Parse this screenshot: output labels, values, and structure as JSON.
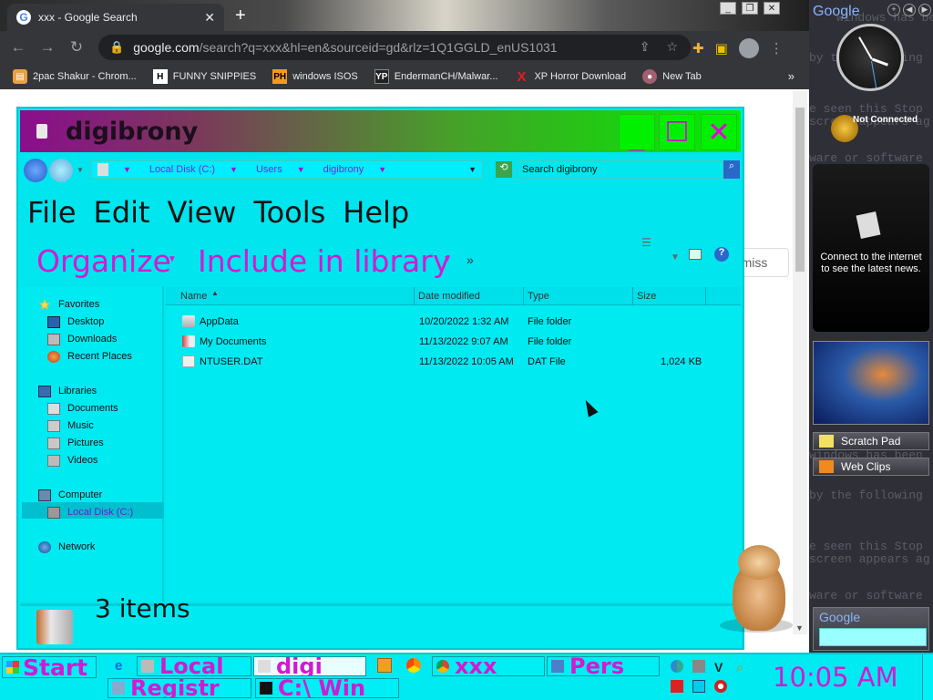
{
  "chrome": {
    "tab_title": "xxx - Google Search",
    "tab_close": "✕",
    "new_tab": "+",
    "url_host": "google.com",
    "url_path": "/search?q=xxx&hl=en&sourceid=gd&rlz=1Q1GGLD_enUS1031",
    "bookmarks": [
      {
        "label": "2pac Shakur - Chrom...",
        "icon": "chrome-store-icon"
      },
      {
        "label": "FUNNY SNIPPIES",
        "icon": "h-logo-icon"
      },
      {
        "label": "windows ISOS",
        "icon": "ph-logo-icon"
      },
      {
        "label": "EndermanCH/Malwar...",
        "icon": "yp-logo-icon"
      },
      {
        "label": "XP Horror Download",
        "icon": "x-logo-icon"
      },
      {
        "label": "New Tab",
        "icon": "globe-icon"
      }
    ],
    "bookmarks_more": "»",
    "dismiss_label": "miss"
  },
  "explorer": {
    "title": "digibrony",
    "breadcrumbs": [
      "Local Disk (C:)",
      "Users",
      "digibrony"
    ],
    "search_placeholder": "Search digibrony",
    "menu": [
      "File",
      "Edit",
      "View",
      "Tools",
      "Help"
    ],
    "commands": {
      "organize": "Organize",
      "include": "Include in library",
      "more": "»"
    },
    "nav": {
      "favorites": "Favorites",
      "favorites_items": [
        "Desktop",
        "Downloads",
        "Recent Places"
      ],
      "libraries": "Libraries",
      "libraries_items": [
        "Documents",
        "Music",
        "Pictures",
        "Videos"
      ],
      "computer": "Computer",
      "computer_items": [
        "Local Disk (C:)"
      ],
      "network": "Network"
    },
    "columns": [
      "Name",
      "Date modified",
      "Type",
      "Size"
    ],
    "files": [
      {
        "name": "AppData",
        "date": "10/20/2022 1:32 AM",
        "type": "File folder",
        "size": ""
      },
      {
        "name": "My Documents",
        "date": "11/13/2022 9:07 AM",
        "type": "File folder",
        "size": ""
      },
      {
        "name": "NTUSER.DAT",
        "date": "11/13/2022 10:05 AM",
        "type": "DAT File",
        "size": "1,024 KB"
      }
    ],
    "item_count": "3 items"
  },
  "sidebar": {
    "brand": "Google",
    "clock_status": "Not Connected",
    "news_message": "Connect to the internet to see the latest news.",
    "scratch_pad": "Scratch Pad",
    "web_clips": "Web Clips",
    "search_brand": "Google",
    "bg_lines": [
      "windows has been",
      "by the following",
      "e seen this Stop",
      "screen appears ag",
      "ware or software",
      "e seen this Stop",
      "windows has been",
      "by the following",
      "e seen this Stop",
      "screen appears ag",
      "ware or software"
    ]
  },
  "taskbar": {
    "start": "Start",
    "tasks_row1": [
      "Local",
      "digi",
      "xxx",
      "Pers"
    ],
    "tasks_row2": [
      "Registr",
      "C:\\ Win"
    ],
    "clock": "10:05 AM"
  }
}
